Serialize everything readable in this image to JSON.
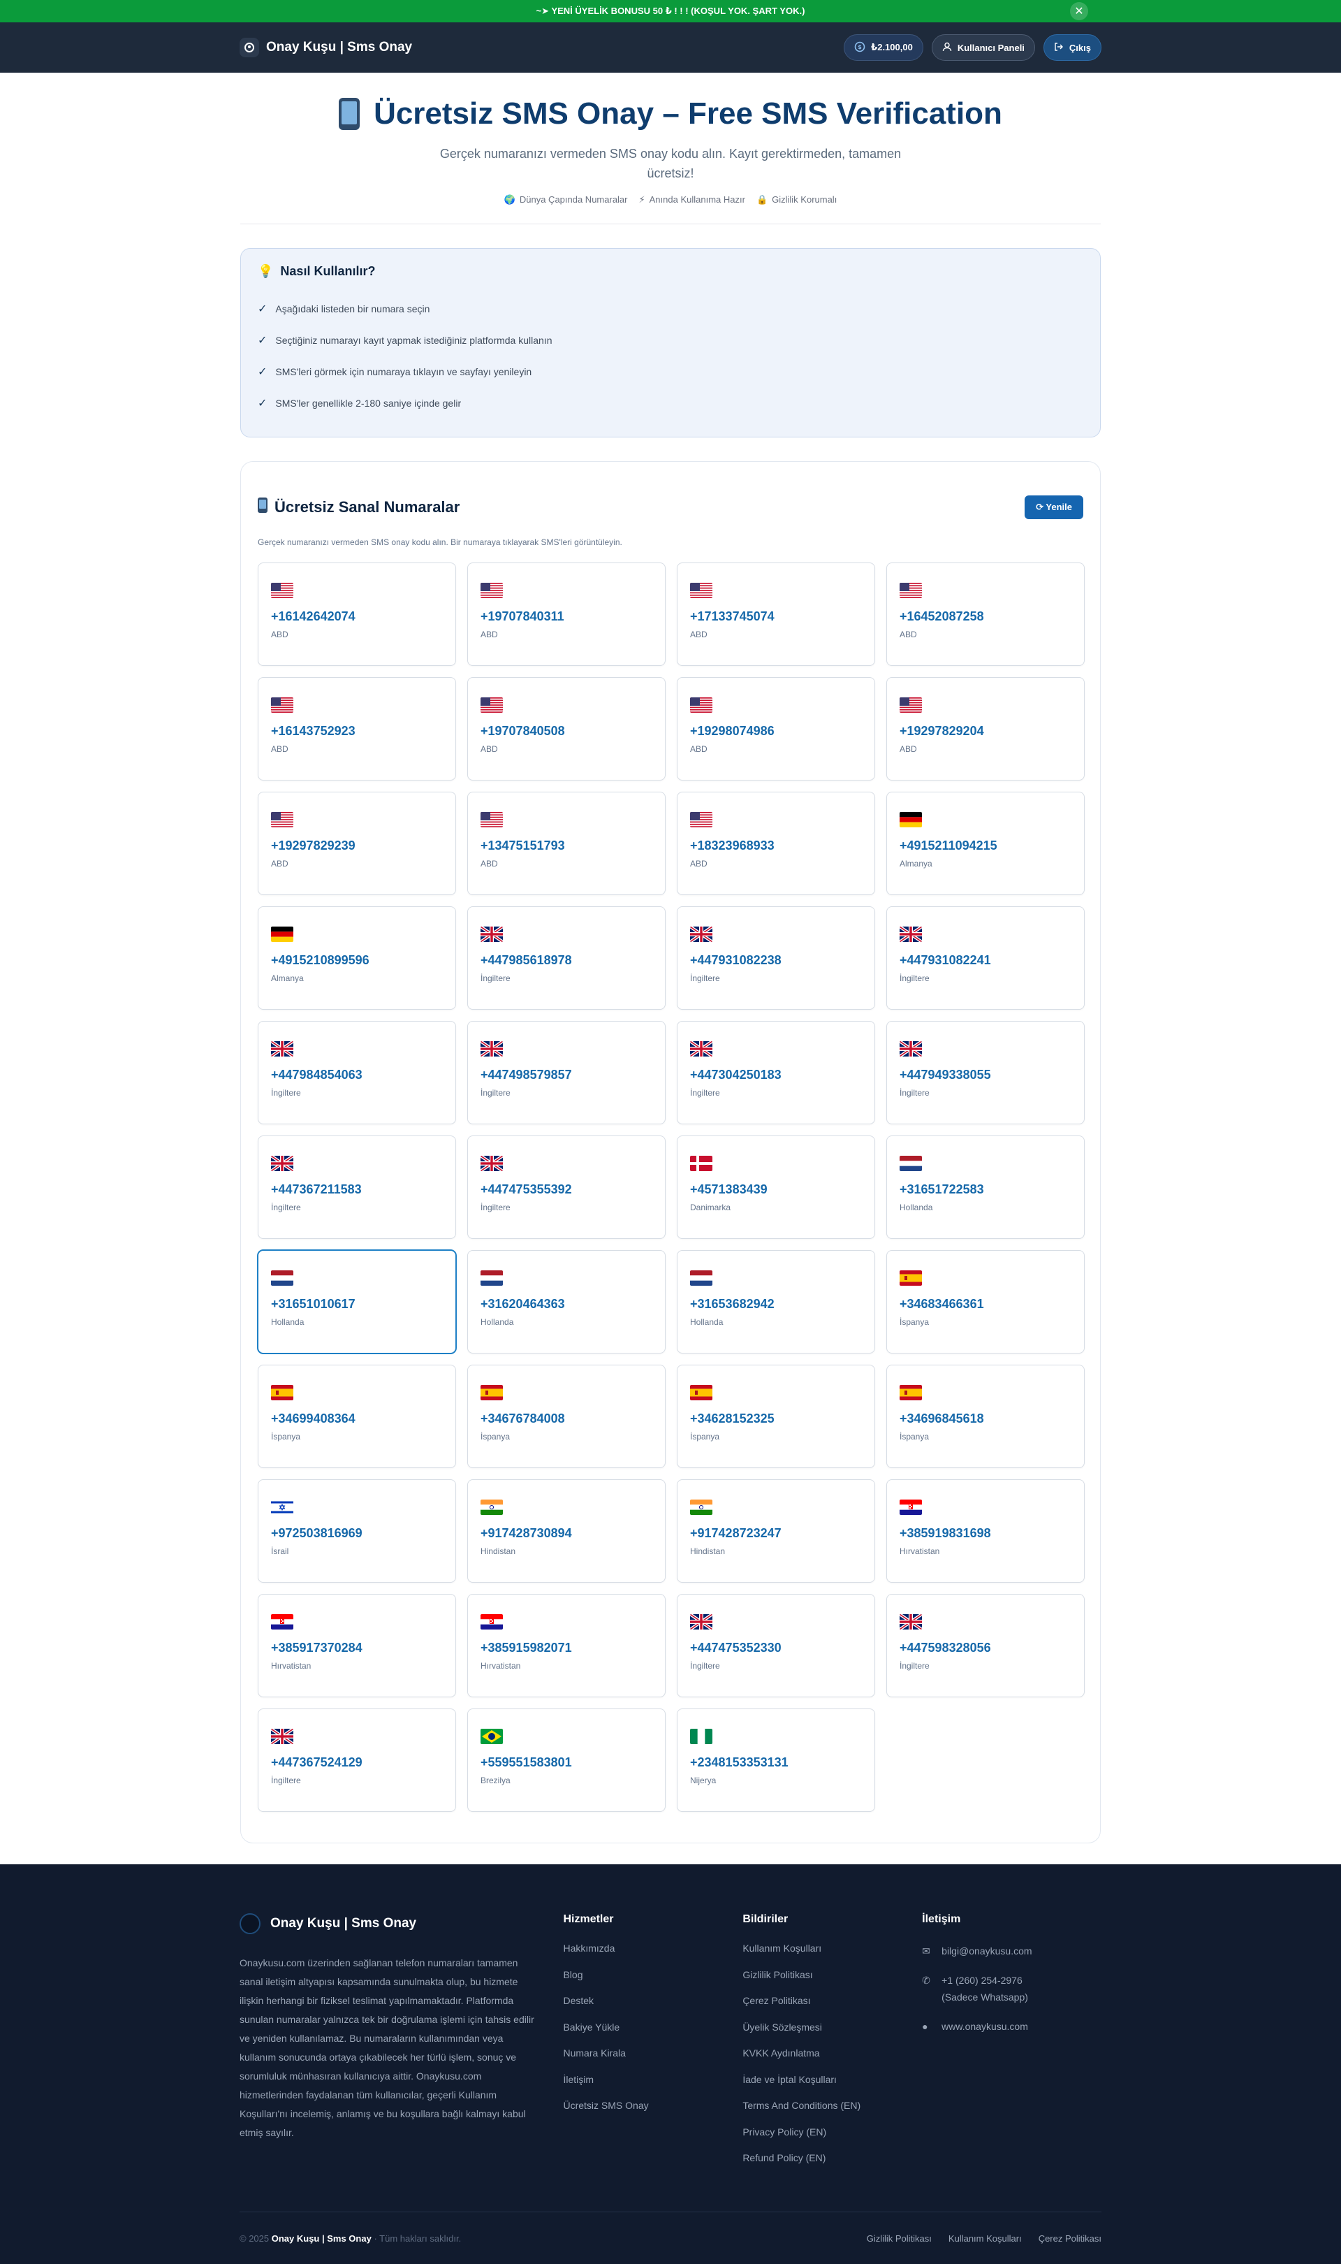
{
  "promo": {
    "text": "~➤ YENİ ÜYELİK BONUSU 50 ₺ ! ! ! (KOŞUL YOK. ŞART YOK.)",
    "close": "✕"
  },
  "nav": {
    "brand": "Onay Kuşu | Sms Onay",
    "balance": "₺2.100,00",
    "panel": "Kullanıcı Paneli",
    "logout": "Çıkış"
  },
  "hero": {
    "title": "Ücretsiz SMS Onay – Free SMS Verification",
    "subtitle": "Gerçek numaranızı vermeden SMS onay kodu alın. Kayıt gerektirmeden, tamamen ücretsiz!",
    "features": [
      {
        "icon": "🌍",
        "label": "Dünya Çapında Numaralar"
      },
      {
        "icon": "⚡",
        "label": "Anında Kullanıma Hazır"
      },
      {
        "icon": "🔒",
        "label": "Gizlilik Korumalı"
      }
    ]
  },
  "howto": {
    "icon": "💡",
    "title": "Nasıl Kullanılır?",
    "steps": [
      "Aşağıdaki listeden bir numara seçin",
      "Seçtiğiniz numarayı kayıt yapmak istediğiniz platformda kullanın",
      "SMS'leri görmek için numaraya tıklayın ve sayfayı yenileyin",
      "SMS'ler genellikle 2-180 saniye içinde gelir"
    ]
  },
  "numbers": {
    "title": "Ücretsiz Sanal Numaralar",
    "refresh": "⟳ Yenile",
    "subtitle": "Gerçek numaranızı vermeden SMS onay kodu alın. Bir numaraya tıklayarak SMS'leri görüntüleyin.",
    "items": [
      {
        "number": "+16142642074",
        "country": "ABD",
        "flag": "us"
      },
      {
        "number": "+19707840311",
        "country": "ABD",
        "flag": "us"
      },
      {
        "number": "+17133745074",
        "country": "ABD",
        "flag": "us"
      },
      {
        "number": "+16452087258",
        "country": "ABD",
        "flag": "us"
      },
      {
        "number": "+16143752923",
        "country": "ABD",
        "flag": "us"
      },
      {
        "number": "+19707840508",
        "country": "ABD",
        "flag": "us"
      },
      {
        "number": "+19298074986",
        "country": "ABD",
        "flag": "us"
      },
      {
        "number": "+19297829204",
        "country": "ABD",
        "flag": "us"
      },
      {
        "number": "+19297829239",
        "country": "ABD",
        "flag": "us"
      },
      {
        "number": "+13475151793",
        "country": "ABD",
        "flag": "us"
      },
      {
        "number": "+18323968933",
        "country": "ABD",
        "flag": "us"
      },
      {
        "number": "+4915211094215",
        "country": "Almanya",
        "flag": "de"
      },
      {
        "number": "+4915210899596",
        "country": "Almanya",
        "flag": "de"
      },
      {
        "number": "+447985618978",
        "country": "İngiltere",
        "flag": "gb"
      },
      {
        "number": "+447931082238",
        "country": "İngiltere",
        "flag": "gb"
      },
      {
        "number": "+447931082241",
        "country": "İngiltere",
        "flag": "gb"
      },
      {
        "number": "+447984854063",
        "country": "İngiltere",
        "flag": "gb"
      },
      {
        "number": "+447498579857",
        "country": "İngiltere",
        "flag": "gb"
      },
      {
        "number": "+447304250183",
        "country": "İngiltere",
        "flag": "gb"
      },
      {
        "number": "+447949338055",
        "country": "İngiltere",
        "flag": "gb"
      },
      {
        "number": "+447367211583",
        "country": "İngiltere",
        "flag": "gb"
      },
      {
        "number": "+447475355392",
        "country": "İngiltere",
        "flag": "gb"
      },
      {
        "number": "+4571383439",
        "country": "Danimarka",
        "flag": "dk"
      },
      {
        "number": "+31651722583",
        "country": "Hollanda",
        "flag": "nl"
      },
      {
        "number": "+31651010617",
        "country": "Hollanda",
        "flag": "nl",
        "active": true
      },
      {
        "number": "+31620464363",
        "country": "Hollanda",
        "flag": "nl"
      },
      {
        "number": "+31653682942",
        "country": "Hollanda",
        "flag": "nl"
      },
      {
        "number": "+34683466361",
        "country": "İspanya",
        "flag": "es"
      },
      {
        "number": "+34699408364",
        "country": "İspanya",
        "flag": "es"
      },
      {
        "number": "+34676784008",
        "country": "İspanya",
        "flag": "es"
      },
      {
        "number": "+34628152325",
        "country": "İspanya",
        "flag": "es"
      },
      {
        "number": "+34696845618",
        "country": "İspanya",
        "flag": "es"
      },
      {
        "number": "+972503816969",
        "country": "İsrail",
        "flag": "il"
      },
      {
        "number": "+917428730894",
        "country": "Hindistan",
        "flag": "in"
      },
      {
        "number": "+917428723247",
        "country": "Hindistan",
        "flag": "in"
      },
      {
        "number": "+385919831698",
        "country": "Hırvatistan",
        "flag": "hr"
      },
      {
        "number": "+385917370284",
        "country": "Hırvatistan",
        "flag": "hr"
      },
      {
        "number": "+385915982071",
        "country": "Hırvatistan",
        "flag": "hr"
      },
      {
        "number": "+447475352330",
        "country": "İngiltere",
        "flag": "gb"
      },
      {
        "number": "+447598328056",
        "country": "İngiltere",
        "flag": "gb"
      },
      {
        "number": "+447367524129",
        "country": "İngiltere",
        "flag": "gb"
      },
      {
        "number": "+559551583801",
        "country": "Brezilya",
        "flag": "br"
      },
      {
        "number": "+2348153353131",
        "country": "Nijerya",
        "flag": "ng"
      }
    ]
  },
  "footer": {
    "brand": "Onay Kuşu | Sms Onay",
    "about": "Onaykusu.com üzerinden sağlanan telefon numaraları tamamen sanal iletişim altyapısı kapsamında sunulmakta olup, bu hizmete ilişkin herhangi bir fiziksel teslimat yapılmamaktadır. Platformda sunulan numaralar yalnızca tek bir doğrulama işlemi için tahsis edilir ve yeniden kullanılamaz. Bu numaraların kullanımından veya kullanım sonucunda ortaya çıkabilecek her türlü işlem, sonuç ve sorumluluk münhasıran kullanıcıya aittir. Onaykusu.com hizmetlerinden faydalanan tüm kullanıcılar, geçerli Kullanım Koşulları'nı incelemiş, anlamış ve bu koşullara bağlı kalmayı kabul etmiş sayılır.",
    "services_title": "Hizmetler",
    "services": [
      "Hakkımızda",
      "Blog",
      "Destek",
      "Bakiye Yükle",
      "Numara Kirala",
      "İletişim",
      "Ücretsiz SMS Onay"
    ],
    "notices_title": "Bildiriler",
    "notices": [
      "Kullanım Koşulları",
      "Gizlilik Politikası",
      "Çerez Politikası",
      "Üyelik Sözleşmesi",
      "KVKK Aydınlatma",
      "İade ve İptal Koşulları",
      "Terms And Conditions (EN)",
      "Privacy Policy (EN)",
      "Refund Policy (EN)"
    ],
    "contact_title": "İletişim",
    "contact": [
      {
        "icon": "✉",
        "text": "bilgi@onaykusu.com"
      },
      {
        "icon": "✆",
        "text": "+1 (260) 254-2976 (Sadece Whatsapp)"
      },
      {
        "icon": "●",
        "text": "www.onaykusu.com"
      }
    ],
    "copyright_prefix": "© 2025",
    "copyright_brand": "Onay Kuşu | Sms Onay",
    "copyright_suffix": "· Tüm hakları saklıdır.",
    "bottom_links": [
      "Gizlilik Politikası",
      "Kullanım Koşulları",
      "Çerez Politikası"
    ]
  }
}
